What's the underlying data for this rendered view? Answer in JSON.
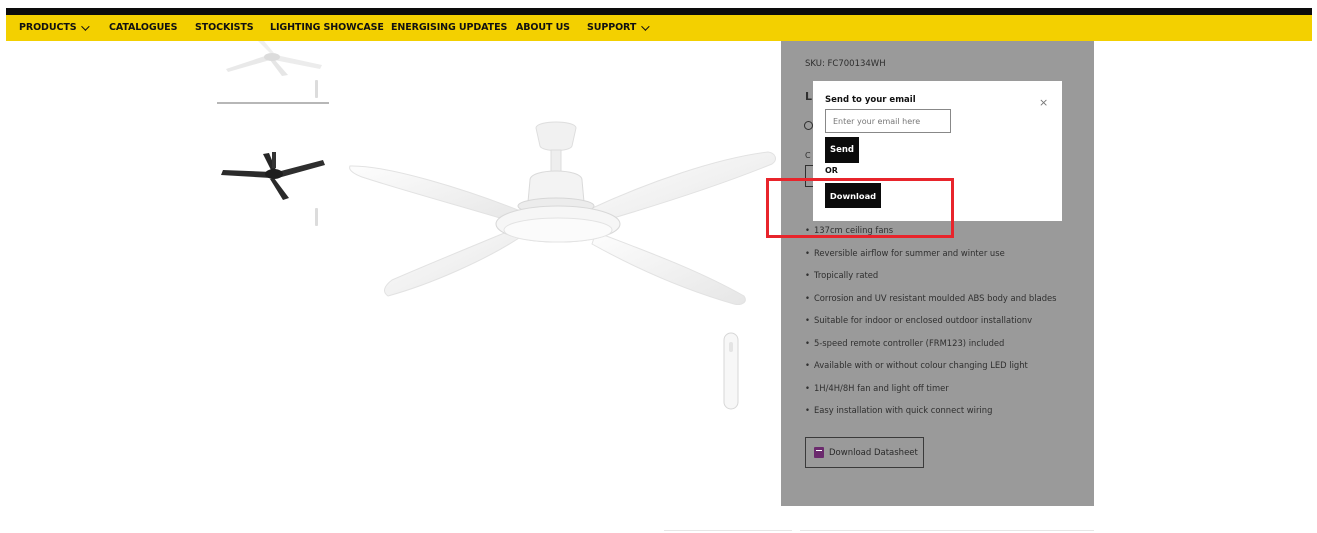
{
  "nav": {
    "items": [
      {
        "label": "PRODUCTS",
        "has_dropdown": true
      },
      {
        "label": "CATALOGUES",
        "has_dropdown": false
      },
      {
        "label": "STOCKISTS",
        "has_dropdown": false
      },
      {
        "label": "LIGHTING SHOWCASE",
        "has_dropdown": false
      },
      {
        "label": "ENERGISING UPDATES",
        "has_dropdown": false
      },
      {
        "label": "ABOUT US",
        "has_dropdown": false
      },
      {
        "label": "SUPPORT",
        "has_dropdown": true
      }
    ]
  },
  "product": {
    "sku": "SKU: FC700134WH",
    "features": [
      "137cm ceiling fans",
      "Reversible airflow for summer and winter use",
      "Tropically rated",
      "Corrosion and UV resistant moulded ABS body and blades",
      "Suitable for indoor or enclosed outdoor installationv",
      "5-speed remote controller (FRM123) included",
      "Available with or without colour changing LED light",
      "1H/4H/8H fan and light off timer",
      "Easy installation with quick connect wiring"
    ],
    "datasheet_label": "Download Datasheet"
  },
  "modal": {
    "title": "Send to your email",
    "close": "×",
    "email_placeholder": "Enter your email here",
    "email_value": "",
    "send_label": "Send",
    "or_label": "OR",
    "download_label": "Download"
  },
  "colors": {
    "nav_bg": "#f3d000",
    "overlay": "#9a9a9a",
    "button_bg": "#0b0b0b",
    "highlight": "#e8242b",
    "pdf_icon": "#6b2a6d"
  }
}
